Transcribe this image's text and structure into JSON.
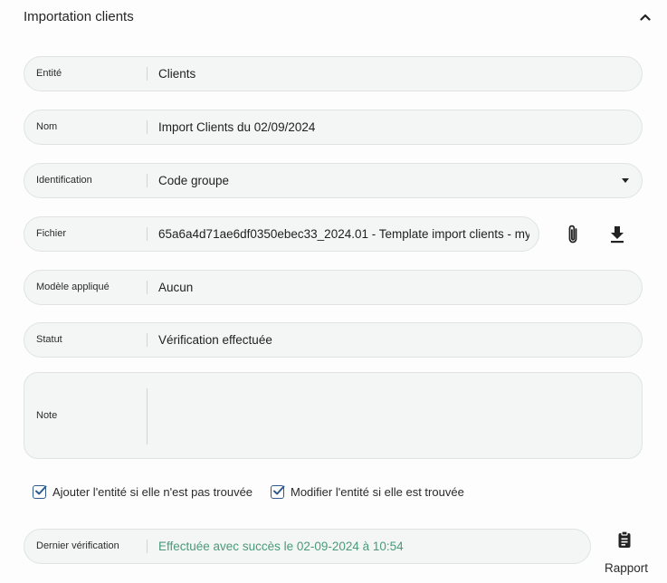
{
  "header": {
    "title": "Importation clients",
    "collapse_icon": "chevron-up-icon"
  },
  "fields": {
    "entite": {
      "label": "Entité",
      "value": "Clients"
    },
    "nom": {
      "label": "Nom",
      "value": "Import Clients du 02/09/2024"
    },
    "identification": {
      "label": "Identification",
      "value": "Code groupe"
    },
    "fichier": {
      "label": "Fichier",
      "value": "65a6a4d71ae6df0350ebec33_2024.01 - Template import clients - my"
    },
    "modele": {
      "label": "Modèle appliqué",
      "value": "Aucun"
    },
    "statut": {
      "label": "Statut",
      "value": "Vérification effectuée"
    },
    "note": {
      "label": "Note",
      "value": ""
    },
    "verification": {
      "label": "Dernier vérification",
      "value": "Effectuée avec succès le 02-09-2024 à 10:54"
    }
  },
  "file_actions": {
    "attach_icon": "paperclip-icon",
    "download_icon": "download-icon"
  },
  "checkboxes": [
    {
      "label": "Ajouter l'entité si elle n'est pas trouvée",
      "checked": true
    },
    {
      "label": "Modifier l'entité si elle est trouvée",
      "checked": true
    }
  ],
  "rapport": {
    "label": "Rapport",
    "icon": "clipboard-icon"
  },
  "colors": {
    "accent": "#2f5a8c",
    "success": "#4a9a7a",
    "field_bg": "#f4f6f6"
  }
}
